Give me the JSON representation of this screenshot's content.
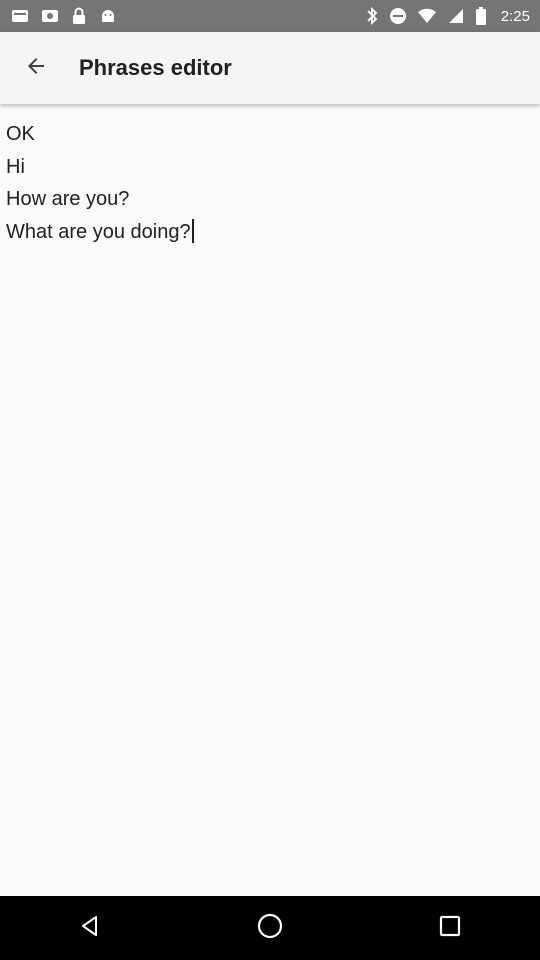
{
  "status_bar": {
    "time": "2:25",
    "left_icons": [
      "notification-a-icon",
      "notification-b-icon",
      "lock-icon",
      "android-icon"
    ],
    "right_icons": [
      "bluetooth-icon",
      "do-not-disturb-icon",
      "wifi-icon",
      "cellular-icon",
      "battery-icon"
    ]
  },
  "app_bar": {
    "title": "Phrases editor",
    "back_icon": "arrow-back-icon"
  },
  "editor": {
    "lines": [
      "OK",
      "Hi",
      "How are you?",
      "What are you doing?"
    ]
  },
  "nav_bar": {
    "buttons": [
      "back-triangle-icon",
      "home-circle-icon",
      "recents-square-icon"
    ]
  },
  "colors": {
    "status_bar": "#757575",
    "app_bar": "#f5f5f5",
    "background": "#fafafa",
    "text": "#212121",
    "nav_bar": "#000000"
  }
}
